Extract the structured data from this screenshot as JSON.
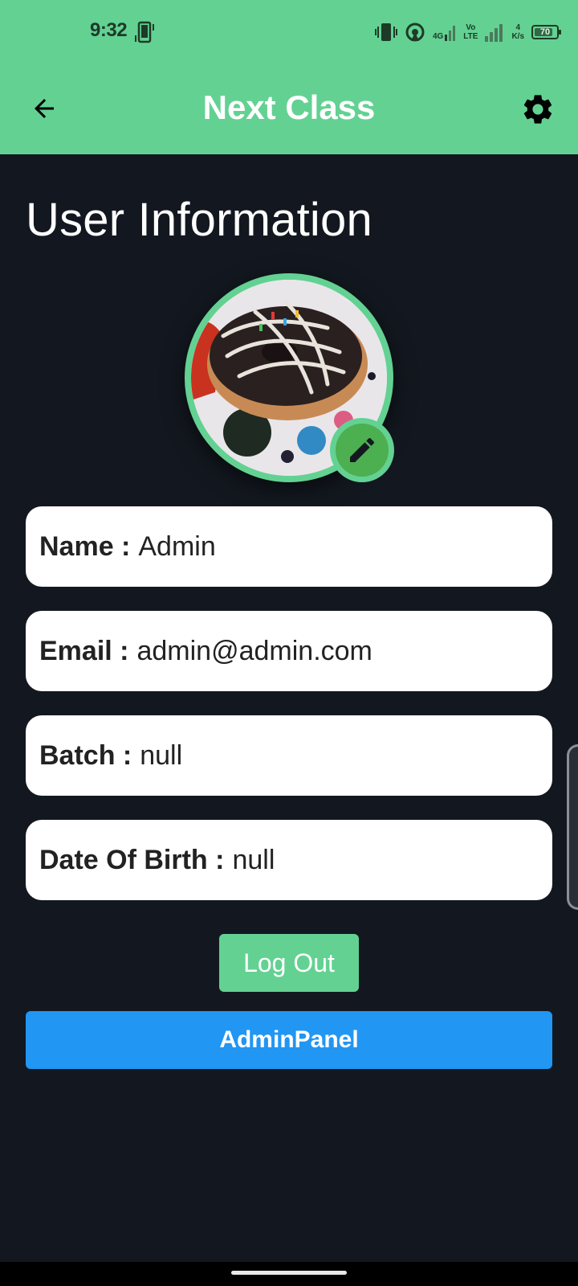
{
  "status_bar": {
    "time": "9:32",
    "network_type": "4G",
    "volte": "Vo\nLTE",
    "speed_value": "4",
    "speed_unit": "K/s",
    "battery": "70"
  },
  "app_bar": {
    "title": "Next Class",
    "back_icon": "arrow-back-icon",
    "settings_icon": "gear-icon"
  },
  "page": {
    "title": "User Information"
  },
  "profile": {
    "edit_icon": "pencil-icon"
  },
  "fields": [
    {
      "label": "Name :",
      "value": "Admin"
    },
    {
      "label": "Email :",
      "value": "admin@admin.com"
    },
    {
      "label": "Batch :",
      "value": "null"
    },
    {
      "label": "Date Of Birth :",
      "value": "null"
    }
  ],
  "actions": {
    "logout_label": "Log Out",
    "admin_label": "AdminPanel"
  },
  "colors": {
    "accent_green": "#63d192",
    "background": "#131820",
    "admin_blue": "#2196f3",
    "edit_green": "#4caf50"
  }
}
